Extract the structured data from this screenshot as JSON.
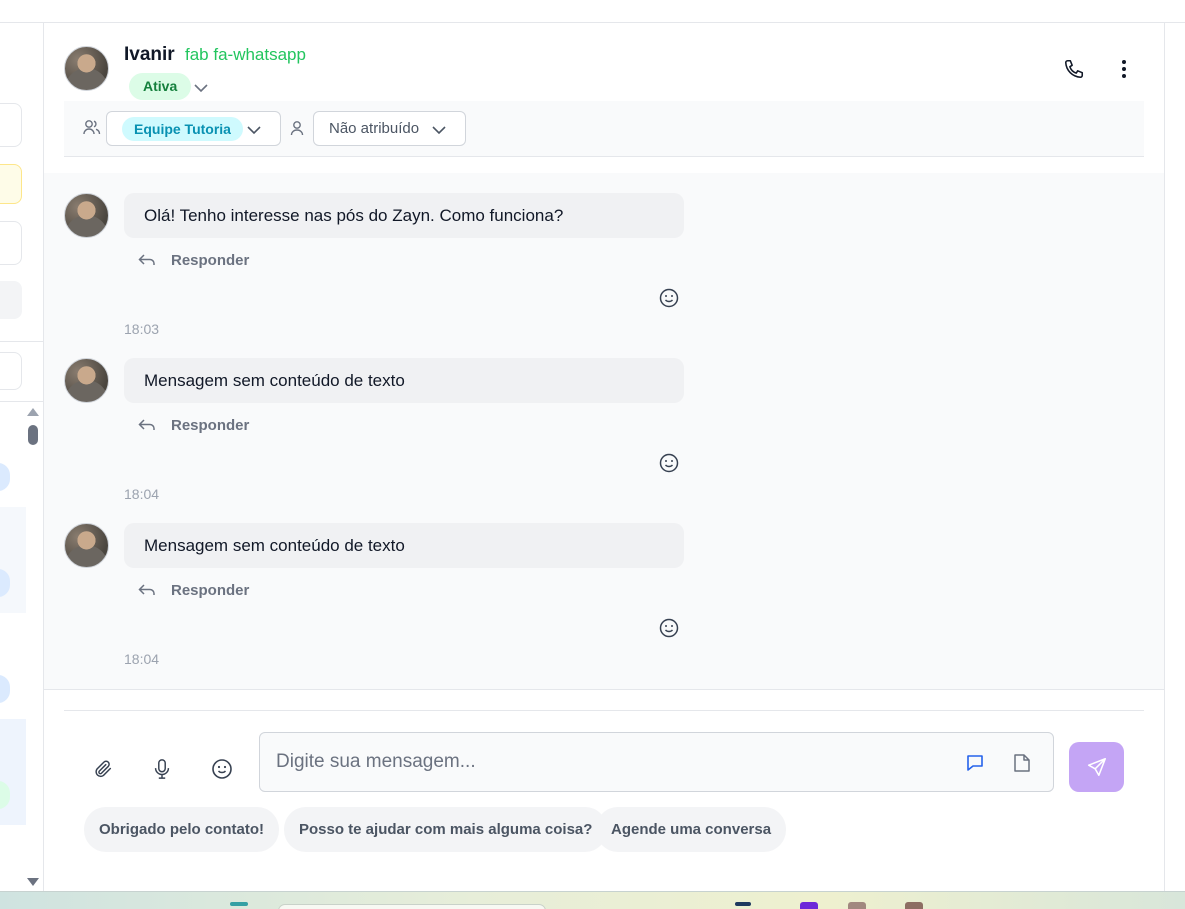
{
  "header": {
    "contact_name": "Ivanir",
    "channel_text": "fab fa-whatsapp",
    "status": "Ativa"
  },
  "assignment": {
    "team": "Equipe Tutoria",
    "agent": "Não atribuído"
  },
  "messages": [
    {
      "text": "Olá! Tenho interesse nas pós do Zayn. Como funciona?",
      "reply_label": "Responder",
      "time": "18:03"
    },
    {
      "text": "Mensagem sem conteúdo de texto",
      "reply_label": "Responder",
      "time": "18:04"
    },
    {
      "text": "Mensagem sem conteúdo de texto",
      "reply_label": "Responder",
      "time": "18:04"
    }
  ],
  "composer": {
    "placeholder": "Digite sua mensagem...",
    "quick_replies": [
      "Obrigado pelo contato!",
      "Posso te ajudar com mais alguma coisa?",
      "Agende uma conversa"
    ]
  },
  "colors": {
    "accent_green": "#22c55e",
    "status_bg": "#dcfce7",
    "team_chip": "#0891b2",
    "send_button": "#c4a5f5",
    "chat_mode_icon": "#2563eb"
  },
  "icons": {
    "phone": "phone-icon",
    "more": "more-vertical-icon",
    "attach": "paperclip-icon",
    "mic": "microphone-icon",
    "emoji": "smile-icon",
    "send": "send-icon",
    "reply": "reply-icon"
  }
}
